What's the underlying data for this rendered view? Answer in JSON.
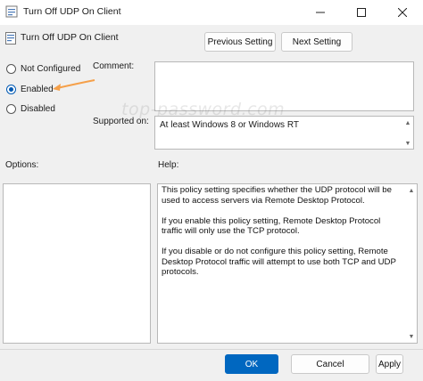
{
  "window": {
    "title": "Turn Off UDP On Client",
    "controls": {
      "minimize": "minimize-icon",
      "maximize": "maximize-icon",
      "close": "close-icon"
    }
  },
  "header": {
    "policy_name": "Turn Off UDP On Client",
    "previous_label": "Previous Setting",
    "next_label": "Next Setting"
  },
  "state": {
    "options": [
      {
        "label": "Not Configured",
        "checked": false
      },
      {
        "label": "Enabled",
        "checked": true
      },
      {
        "label": "Disabled",
        "checked": false
      }
    ]
  },
  "comment": {
    "label": "Comment:",
    "value": ""
  },
  "supported": {
    "label": "Supported on:",
    "value": "At least Windows 8 or Windows RT"
  },
  "watermark": "top-password.com",
  "options_panel": {
    "label": "Options:"
  },
  "help_panel": {
    "label": "Help:",
    "paragraphs": [
      "This policy setting specifies whether the UDP protocol will be used to access servers via Remote Desktop Protocol.",
      "If you enable this policy setting, Remote Desktop Protocol traffic will only use the TCP protocol.",
      "If you disable or do not configure this policy setting, Remote Desktop Protocol traffic will attempt to use both TCP and UDP protocols."
    ]
  },
  "footer": {
    "ok_label": "OK",
    "cancel_label": "Cancel",
    "apply_label": "Apply"
  },
  "colors": {
    "accent": "#0067c0",
    "arrow": "#f5a04a",
    "radio_selected": "#0059b3"
  }
}
